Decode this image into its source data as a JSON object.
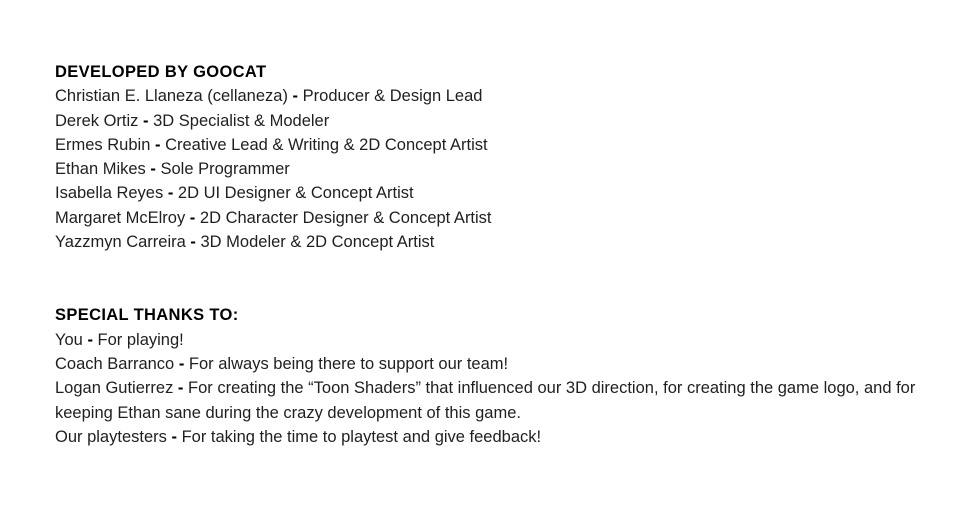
{
  "developers": {
    "heading": "DEVELOPED BY GOOCAT",
    "entries": [
      {
        "name": "Christian E. Llaneza (cellaneza)",
        "role": "Producer & Design Lead"
      },
      {
        "name": "Derek Ortiz",
        "role": "3D Specialist & Modeler"
      },
      {
        "name": "Ermes Rubin",
        "role": "Creative Lead & Writing & 2D Concept Artist"
      },
      {
        "name": "Ethan Mikes",
        "role": "Sole Programmer"
      },
      {
        "name": "Isabella Reyes",
        "role": "2D UI Designer & Concept Artist"
      },
      {
        "name": "Margaret McElroy",
        "role": "2D Character Designer & Concept Artist"
      },
      {
        "name": "Yazzmyn Carreira",
        "role": "3D Modeler & 2D Concept Artist"
      }
    ]
  },
  "thanks": {
    "heading": "SPECIAL THANKS TO:",
    "entries": [
      {
        "name": "You",
        "role": "For playing!"
      },
      {
        "name": "Coach Barranco",
        "role": "For always being there to support our team!"
      },
      {
        "name": "Logan Gutierrez",
        "role": "For creating the “Toon Shaders” that influenced our 3D direction, for creating the game logo, and for keeping Ethan sane during the crazy development of this game."
      },
      {
        "name": "Our playtesters",
        "role": "For taking the time to playtest and give feedback!"
      }
    ]
  },
  "separator": "-"
}
